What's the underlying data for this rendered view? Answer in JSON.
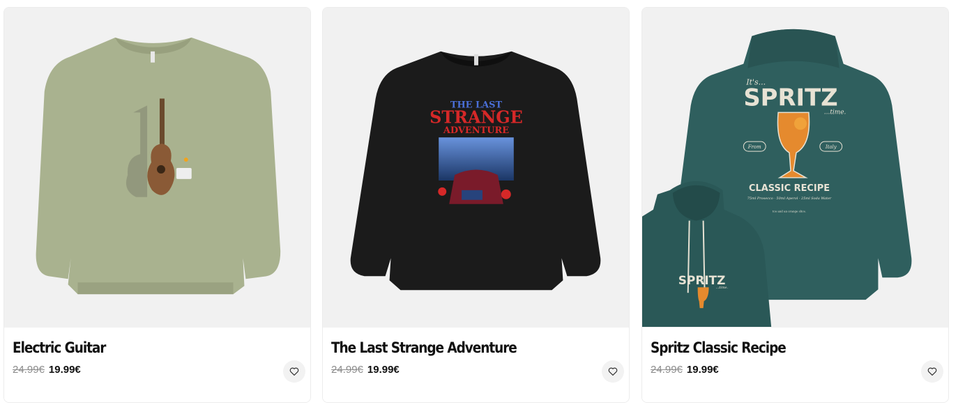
{
  "products": [
    {
      "title": "Electric Guitar",
      "old_price": "24.99€",
      "price": "19.99€",
      "image_icon": "green-sweatshirt-guitar-image",
      "garment_color": "#a9b28f"
    },
    {
      "title": "The Last Strange Adventure",
      "old_price": "24.99€",
      "price": "19.99€",
      "image_icon": "black-sweatshirt-strange-adventure-image",
      "garment_color": "#1b1b1b",
      "print_text": {
        "line1": "THE LAST",
        "line2": "STRANGE",
        "line3": "ADVENTURE"
      }
    },
    {
      "title": "Spritz Classic Recipe",
      "old_price": "24.99€",
      "price": "19.99€",
      "image_icon": "teal-hoodie-spritz-image",
      "garment_color": "#2f5f5e",
      "print_text": {
        "its": "It's...",
        "spritz": "SPRITZ",
        "time": "...time.",
        "from": "From",
        "italy": "Italy",
        "recipe": "CLASSIC RECIPE",
        "ingredients": "75ml Prosecco · 50ml Aperol · 25ml Soda Water",
        "serve": "Ice and an orange slice.",
        "small_spritz": "SPRITZ",
        "small_time": "...time."
      }
    }
  ],
  "favorite_icon": "heart-outline-icon"
}
